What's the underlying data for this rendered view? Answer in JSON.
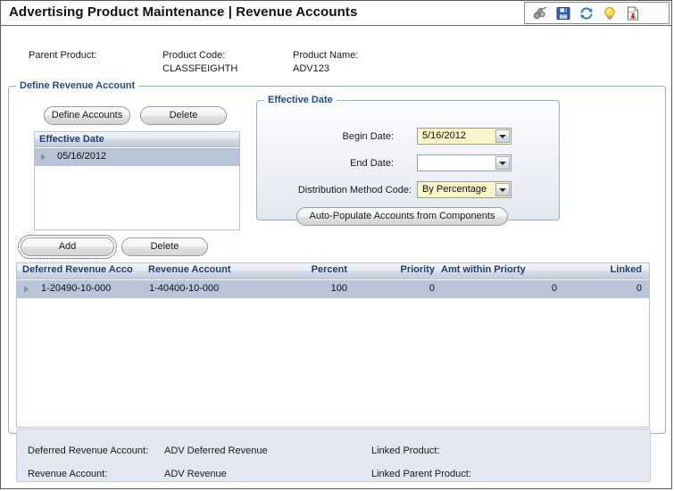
{
  "window": {
    "title": "Advertising Product Maintenance  |  Revenue Accounts"
  },
  "toolbar": {
    "icons": [
      {
        "name": "binoculars-icon",
        "label": "Search"
      },
      {
        "name": "save-icon",
        "label": "Save"
      },
      {
        "name": "refresh-icon",
        "label": "Refresh"
      },
      {
        "name": "lightbulb-icon",
        "label": "Hint"
      },
      {
        "name": "report-icon",
        "label": "Report"
      }
    ]
  },
  "header": {
    "parent_product_label": "Parent Product:",
    "parent_product_value": "",
    "product_code_label": "Product Code:",
    "product_code_value": "CLASSFEIGHTH",
    "product_name_label": "Product Name:",
    "product_name_value": "ADV123"
  },
  "define_revenue_account": {
    "legend": "Define Revenue Account",
    "define_accounts_button": "Define Accounts",
    "delete_button": "Delete",
    "effective_date_list": {
      "column_header": "Effective Date",
      "rows": [
        {
          "date": "05/16/2012"
        }
      ]
    }
  },
  "effective_date_panel": {
    "legend": "Effective Date",
    "begin_date_label": "Begin Date:",
    "begin_date_value": "5/16/2012",
    "end_date_label": "End Date:",
    "end_date_value": "",
    "distribution_method_label": "Distribution Method Code:",
    "distribution_method_value": "By Percentage",
    "auto_populate_button": "Auto-Populate Accounts from Components"
  },
  "grid_toolbar": {
    "add_button": "Add",
    "delete_button": "Delete"
  },
  "grid": {
    "columns": [
      "Deferred Revenue Acco",
      "Revenue Account",
      "Percent",
      "Priority",
      "Amt within Priorty",
      "Linked"
    ],
    "rows": [
      {
        "deferred_revenue_account": "1-20490-10-000",
        "revenue_account": "1-40400-10-000",
        "percent": "100",
        "priority": "0",
        "amt_within_priority": "0",
        "linked": "0"
      }
    ]
  },
  "footer": {
    "deferred_revenue_account_label": "Deferred Revenue Account:",
    "deferred_revenue_account_value": "ADV Deferred Revenue",
    "revenue_account_label": "Revenue Account:",
    "revenue_account_value": "ADV Revenue",
    "linked_product_label": "Linked Product:",
    "linked_product_value": "",
    "linked_parent_product_label": "Linked Parent Product:",
    "linked_parent_product_value": ""
  },
  "colors": {
    "legend_blue": "#1f4e8c",
    "grid_header_text": "#1f3d70",
    "selected_row": "#b8c5d9",
    "highlight_field": "#fbf4c8",
    "footer_bg": "#e3e7ef"
  }
}
